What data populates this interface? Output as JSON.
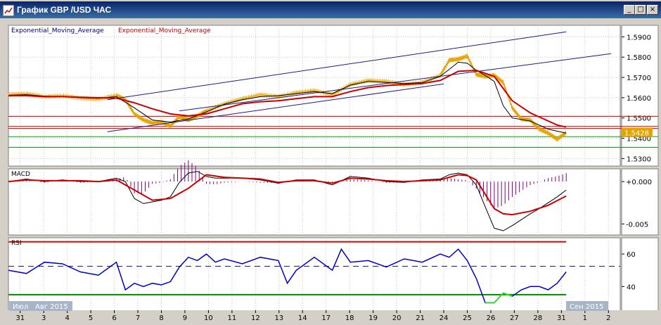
{
  "window": {
    "title": "График GBP /USD ЧАС",
    "buttons": [
      "_",
      "□",
      "×"
    ]
  },
  "colors": {
    "plot_bg": "#ffffff",
    "price": "#e6a300",
    "ema_fast": "#000000",
    "ema_slow": "#cc0000",
    "channel": "#1a1a8c",
    "hline_red": "#cc0000",
    "hline_green": "#00aa00",
    "macd_hist": "#800080",
    "rsi": "#0000cc",
    "rsi_low": "#33dd33",
    "rsi_upper_line": "#ee0000",
    "rsi_lower_line": "#008800",
    "last_price_bg": "#e6a300"
  },
  "chart_data": [
    {
      "type": "line",
      "panel": "price",
      "legend": [
        "Exponential_Moving_Average",
        "Exponential_Moving_Average"
      ],
      "yticks": [
        "1.5900",
        "1.5800",
        "1.5700",
        "1.5600",
        "1.5500",
        "1.5400",
        "1.5300"
      ],
      "ytick_values": [
        1.59,
        1.58,
        1.57,
        1.56,
        1.55,
        1.54,
        1.53
      ],
      "ylim": [
        1.5263,
        1.5957
      ],
      "last_price_label": "1.5428",
      "last_price": 1.5428,
      "x_range": [
        0,
        34
      ],
      "series": [
        {
          "key": "close",
          "x": [
            0,
            1,
            2,
            3,
            4,
            5,
            6,
            6.5,
            7,
            7.5,
            8,
            8.5,
            9,
            9.5,
            10,
            10.5,
            11,
            12,
            13,
            14,
            15,
            16,
            17,
            18,
            19,
            20,
            21,
            22,
            23,
            24,
            24.5,
            25,
            25.5,
            26,
            26.5,
            27,
            27.5,
            28,
            28.5,
            29,
            29.5,
            30,
            30.5,
            31
          ],
          "y": [
            1.5615,
            1.562,
            1.5605,
            1.561,
            1.5598,
            1.5592,
            1.5612,
            1.559,
            1.552,
            1.549,
            1.5475,
            1.548,
            1.546,
            1.5505,
            1.549,
            1.551,
            1.5535,
            1.557,
            1.5595,
            1.5615,
            1.5605,
            1.5625,
            1.5635,
            1.5615,
            1.5665,
            1.5685,
            1.568,
            1.5665,
            1.5675,
            1.571,
            1.5785,
            1.579,
            1.5805,
            1.5715,
            1.5705,
            1.571,
            1.5675,
            1.555,
            1.5495,
            1.549,
            1.5445,
            1.5425,
            1.5395,
            1.5428
          ]
        },
        {
          "key": "ema_fast",
          "x": [
            0,
            1,
            2,
            3,
            4,
            5,
            6,
            7,
            8,
            9,
            10,
            11,
            12,
            13,
            14,
            15,
            16,
            17,
            18,
            19,
            20,
            21,
            22,
            23,
            24,
            25,
            25.5,
            26,
            26.5,
            27,
            27.5,
            28,
            29,
            30,
            31
          ],
          "y": [
            1.5612,
            1.5615,
            1.5608,
            1.5605,
            1.56,
            1.5597,
            1.5605,
            1.555,
            1.549,
            1.548,
            1.5495,
            1.553,
            1.5568,
            1.559,
            1.5605,
            1.561,
            1.562,
            1.563,
            1.562,
            1.5662,
            1.568,
            1.5675,
            1.567,
            1.5675,
            1.5705,
            1.5775,
            1.577,
            1.5735,
            1.571,
            1.568,
            1.556,
            1.55,
            1.5485,
            1.5445,
            1.5425
          ]
        },
        {
          "key": "ema_slow",
          "x": [
            0,
            1,
            2,
            3,
            4,
            5,
            6,
            7,
            8,
            9,
            10,
            11,
            12,
            13,
            14,
            15,
            16,
            17,
            18,
            19,
            20,
            21,
            22,
            23,
            24,
            25,
            26,
            27,
            27.5,
            28,
            29,
            30,
            30.5,
            31
          ],
          "y": [
            1.561,
            1.561,
            1.5605,
            1.5605,
            1.5602,
            1.56,
            1.5598,
            1.5575,
            1.5545,
            1.552,
            1.551,
            1.552,
            1.5545,
            1.557,
            1.558,
            1.5585,
            1.5595,
            1.5605,
            1.5605,
            1.563,
            1.565,
            1.566,
            1.5665,
            1.567,
            1.5685,
            1.573,
            1.5735,
            1.5705,
            1.5645,
            1.5585,
            1.5525,
            1.5485,
            1.5465,
            1.5455
          ]
        },
        {
          "key": "channel_top",
          "x": [
            5.5,
            31
          ],
          "y": [
            1.559,
            1.5925
          ]
        },
        {
          "key": "channel_mid",
          "x": [
            9.5,
            33.5
          ],
          "y": [
            1.5535,
            1.5817
          ]
        },
        {
          "key": "channel_bot",
          "x": [
            5.5,
            24.2
          ],
          "y": [
            1.5432,
            1.5668
          ]
        }
      ],
      "hlines": [
        {
          "y": 1.5508,
          "color": "red"
        },
        {
          "y": 1.5458,
          "color": "red"
        },
        {
          "y": 1.5448,
          "color": "red"
        },
        {
          "y": 1.5408,
          "color": "green"
        },
        {
          "y": 1.5355,
          "color": "green"
        }
      ]
    },
    {
      "type": "line",
      "panel": "macd",
      "legend": [
        "MACD"
      ],
      "yticks": [
        "+0.000",
        "-0.005"
      ],
      "ytick_values": [
        0,
        -0.005
      ],
      "ylim": [
        -0.0063,
        0.0015
      ],
      "series": [
        {
          "key": "macd",
          "x": [
            0,
            1,
            2,
            3,
            4,
            5,
            6,
            6.5,
            7,
            7.5,
            8,
            8.5,
            9,
            9.5,
            10,
            10.5,
            11,
            11.5,
            12,
            13,
            14,
            15,
            16,
            17,
            18,
            19,
            20,
            21,
            22,
            23,
            24,
            24.5,
            25,
            25.5,
            26,
            26.5,
            27,
            27.5,
            28,
            28.5,
            29,
            29.5,
            30,
            30.5,
            31
          ],
          "y": [
            0,
            0.0003,
            0,
            0.0002,
            0,
            0,
            0.0004,
            0,
            -0.002,
            -0.0026,
            -0.0024,
            -0.0022,
            -0.0018,
            -0.0001,
            0.001,
            0.0012,
            0.0006,
            0.0004,
            0.0004,
            0.0004,
            0.0002,
            -0.0002,
            0.0002,
            0.0002,
            -0.0004,
            0.0006,
            0.0004,
            0,
            -0.0001,
            0.0002,
            0.0003,
            0.0008,
            0.001,
            0.0008,
            -0.0004,
            -0.003,
            -0.0055,
            -0.0058,
            -0.0052,
            -0.0045,
            -0.0038,
            -0.0032,
            -0.0025,
            -0.0018,
            -0.001
          ]
        },
        {
          "key": "signal",
          "x": [
            0,
            1,
            2,
            3,
            4,
            5,
            6,
            7,
            8,
            9,
            10,
            11,
            12,
            13,
            14,
            15,
            16,
            17,
            18,
            19,
            20,
            21,
            22,
            23,
            24,
            25,
            25.5,
            26,
            26.5,
            27,
            27.5,
            28,
            29,
            30,
            31
          ],
          "y": [
            0,
            0.0002,
            0.0001,
            0.0001,
            0.0001,
            0,
            0.0002,
            -0.001,
            -0.0022,
            -0.002,
            -0.0008,
            0.0008,
            0.0005,
            0.0004,
            0.0003,
            -0.0001,
            0.0001,
            0.0001,
            -0.0002,
            0.0004,
            0.0003,
            0.0001,
            0,
            0.0001,
            0.0002,
            0.0008,
            0.0007,
            0.0002,
            -0.0015,
            -0.0032,
            -0.0038,
            -0.0039,
            -0.0035,
            -0.0028,
            -0.0017
          ]
        }
      ]
    },
    {
      "type": "line",
      "panel": "rsi",
      "legend": [
        "RSI"
      ],
      "yticks": [
        "60",
        "40"
      ],
      "ytick_values": [
        60,
        40
      ],
      "ylim": [
        25,
        70
      ],
      "series": [
        {
          "key": "rsi",
          "x": [
            0,
            1,
            2,
            3,
            4,
            5,
            6,
            6.5,
            7,
            7.5,
            8,
            8.5,
            9,
            9.5,
            10,
            10.5,
            11,
            11.5,
            12,
            13,
            14,
            15,
            15.5,
            16,
            17,
            18,
            18.5,
            19,
            20,
            21,
            22,
            23,
            24,
            24.5,
            25,
            25.5,
            26,
            26.5,
            27,
            27.5,
            28,
            28.5,
            29,
            29.5,
            30,
            30.5,
            31
          ],
          "y": [
            50,
            48,
            55,
            54,
            49,
            47,
            55,
            38,
            42,
            40,
            42,
            41,
            43,
            52,
            58,
            56,
            60,
            55,
            57,
            54,
            58,
            56,
            42,
            50,
            58,
            50,
            63,
            55,
            56,
            52,
            57,
            55,
            60,
            58,
            63,
            56,
            45,
            30,
            30,
            36,
            34,
            38,
            40,
            40,
            38,
            42,
            49
          ]
        }
      ],
      "hlines": [
        {
          "y": 67.5,
          "color": "red"
        },
        {
          "y": 52.5,
          "color": "dashed"
        },
        {
          "y": 35,
          "color": "green"
        }
      ]
    },
    {
      "type": "table",
      "panel": "xaxis",
      "xticks": [
        "31",
        "3",
        "4",
        "5",
        "6",
        "7",
        "8",
        "9",
        "10",
        "11",
        "12",
        "13",
        "14",
        "17",
        "18",
        "19",
        "20",
        "21",
        "24",
        "25",
        "26",
        "27",
        "28",
        "31",
        "1",
        "2"
      ],
      "xtick_positions": [
        0,
        1,
        2,
        3,
        4,
        5,
        6,
        7,
        8,
        9,
        10,
        11,
        12,
        13,
        14,
        15,
        16,
        17,
        18,
        19,
        20,
        21,
        22,
        23,
        24,
        25
      ],
      "month_labels": [
        "Июл",
        "Авг 2015",
        "Сен 2015"
      ]
    }
  ]
}
